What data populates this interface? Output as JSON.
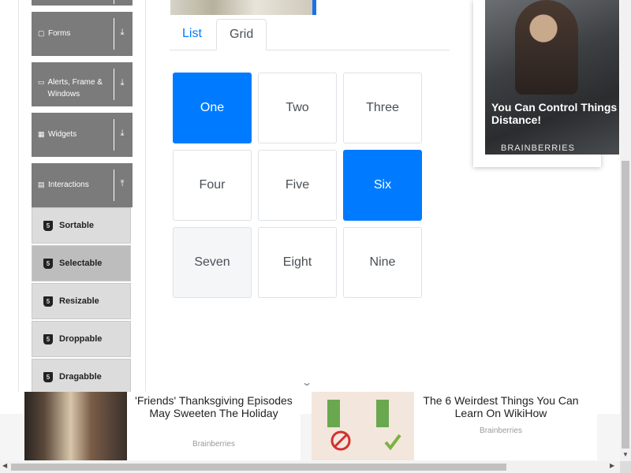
{
  "sidebar": {
    "groups": [
      {
        "label": "Forms",
        "icon": "form-icon"
      },
      {
        "label": "Alerts, Frame & Windows",
        "icon": "window-icon"
      },
      {
        "label": "Widgets",
        "icon": "widgets-icon"
      },
      {
        "label": "Interactions",
        "icon": "interactions-icon"
      }
    ],
    "items": [
      {
        "label": "Sortable"
      },
      {
        "label": "Selectable"
      },
      {
        "label": "Resizable"
      },
      {
        "label": "Droppable"
      },
      {
        "label": "Dragabble"
      }
    ]
  },
  "tabs": [
    {
      "label": "List"
    },
    {
      "label": "Grid"
    }
  ],
  "grid": {
    "cells": [
      "One",
      "Two",
      "Three",
      "Four",
      "Five",
      "Six",
      "Seven",
      "Eight",
      "Nine"
    ]
  },
  "ad_right": {
    "caption": "You Can Control Things Distance!",
    "brand": "BRAINBERRIES"
  },
  "ad_bottom": {
    "card1": {
      "title": "'Friends' Thanksgiving Episodes May Sweeten The Holiday",
      "source": "Brainberries"
    },
    "card2": {
      "title": "The 6 Weirdest Things You Can Learn On WikiHow",
      "source": "Brainberries"
    }
  },
  "colors": {
    "accent": "#007bff",
    "sidebar_group": "#7b7b7b",
    "sidebar_item": "#dcdcdc"
  }
}
